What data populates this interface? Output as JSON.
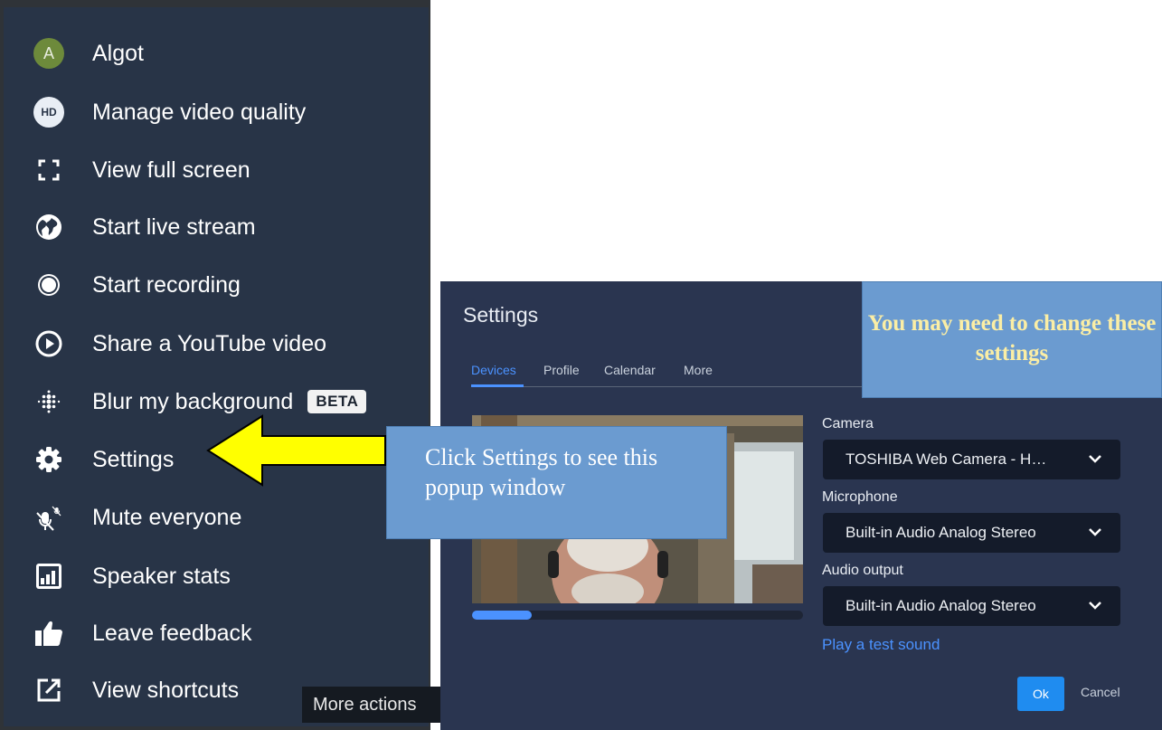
{
  "menu": {
    "items": [
      {
        "label": "Algot",
        "icon": "avatar",
        "avatar_letter": "A"
      },
      {
        "label": "Manage video quality",
        "icon": "hd-icon",
        "badge_text": "HD"
      },
      {
        "label": "View full screen",
        "icon": "fullscreen-icon"
      },
      {
        "label": "Start live stream",
        "icon": "globe-icon"
      },
      {
        "label": "Start recording",
        "icon": "record-icon"
      },
      {
        "label": "Share a YouTube video",
        "icon": "play-circle-icon"
      },
      {
        "label": "Blur my background",
        "icon": "blur-icon",
        "tag": "BETA"
      },
      {
        "label": "Settings",
        "icon": "gear-icon"
      },
      {
        "label": "Mute everyone",
        "icon": "mute-everyone-icon"
      },
      {
        "label": "Speaker stats",
        "icon": "stats-icon"
      },
      {
        "label": "Leave feedback",
        "icon": "thumbs-up-icon"
      },
      {
        "label": "View shortcuts",
        "icon": "external-link-icon"
      }
    ],
    "tooltip": "More actions"
  },
  "dialog": {
    "title": "Settings",
    "tabs": [
      "Devices",
      "Profile",
      "Calendar",
      "More"
    ],
    "active_tab": "Devices",
    "camera": {
      "label": "Camera",
      "value": "TOSHIBA Web Camera - H…"
    },
    "microphone": {
      "label": "Microphone",
      "value": "Built-in Audio Analog Stereo"
    },
    "audio_output": {
      "label": "Audio output",
      "value": "Built-in Audio Analog Stereo"
    },
    "test_sound": "Play a test sound",
    "ok": "Ok",
    "cancel": "Cancel",
    "mic_level": 0.18
  },
  "callouts": {
    "settings": "Click Settings to see this popup window",
    "change": "You may need to change these settings"
  },
  "colors": {
    "menu_bg": "#283447",
    "dialog_bg": "#2a3550",
    "accent": "#4b92ff",
    "callout_bg": "#6b9bd0",
    "callout_text_highlight": "#fbeea5",
    "arrow_fill": "#ffff00"
  }
}
